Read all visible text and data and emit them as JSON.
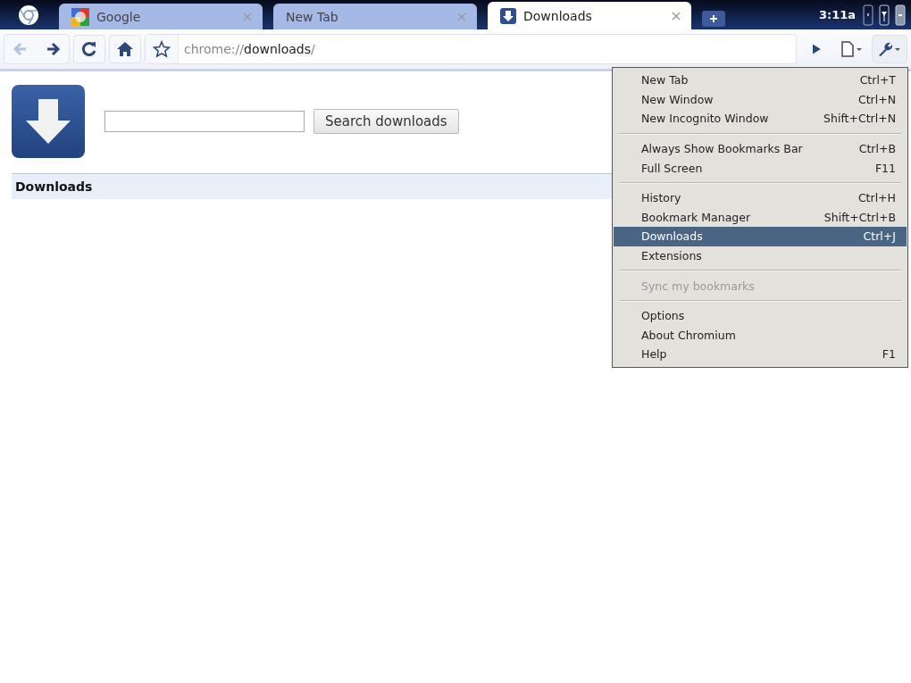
{
  "tabs": [
    {
      "title": "Google",
      "selected": false
    },
    {
      "title": "New Tab",
      "selected": false
    },
    {
      "title": "Downloads",
      "selected": true
    }
  ],
  "status": {
    "time": "3:11a"
  },
  "address": {
    "scheme": "chrome://",
    "host": "downloads",
    "path": "/"
  },
  "page": {
    "search_button": "Search downloads",
    "section_title": "Downloads"
  },
  "menu": [
    {
      "kind": "item",
      "label": "New Tab",
      "shortcut": "Ctrl+T",
      "selected": false,
      "disabled": false
    },
    {
      "kind": "item",
      "label": "New Window",
      "shortcut": "Ctrl+N",
      "selected": false,
      "disabled": false
    },
    {
      "kind": "item",
      "label": "New Incognito Window",
      "shortcut": "Shift+Ctrl+N",
      "selected": false,
      "disabled": false
    },
    {
      "kind": "separator"
    },
    {
      "kind": "item",
      "label": "Always Show Bookmarks Bar",
      "shortcut": "Ctrl+B",
      "selected": false,
      "disabled": false
    },
    {
      "kind": "item",
      "label": "Full Screen",
      "shortcut": "F11",
      "selected": false,
      "disabled": false
    },
    {
      "kind": "separator"
    },
    {
      "kind": "item",
      "label": "History",
      "shortcut": "Ctrl+H",
      "selected": false,
      "disabled": false
    },
    {
      "kind": "item",
      "label": "Bookmark Manager",
      "shortcut": "Shift+Ctrl+B",
      "selected": false,
      "disabled": false
    },
    {
      "kind": "item",
      "label": "Downloads",
      "shortcut": "Ctrl+J",
      "selected": true,
      "disabled": false
    },
    {
      "kind": "item",
      "label": "Extensions",
      "selected": false,
      "disabled": false
    },
    {
      "kind": "separator"
    },
    {
      "kind": "item",
      "label": "Sync my bookmarks",
      "selected": false,
      "disabled": true
    },
    {
      "kind": "separator"
    },
    {
      "kind": "item",
      "label": "Options",
      "selected": false,
      "disabled": false
    },
    {
      "kind": "item",
      "label": "About Chromium",
      "selected": false,
      "disabled": false
    },
    {
      "kind": "item",
      "label": "Help",
      "shortcut": "F1",
      "selected": false,
      "disabled": false
    }
  ]
}
